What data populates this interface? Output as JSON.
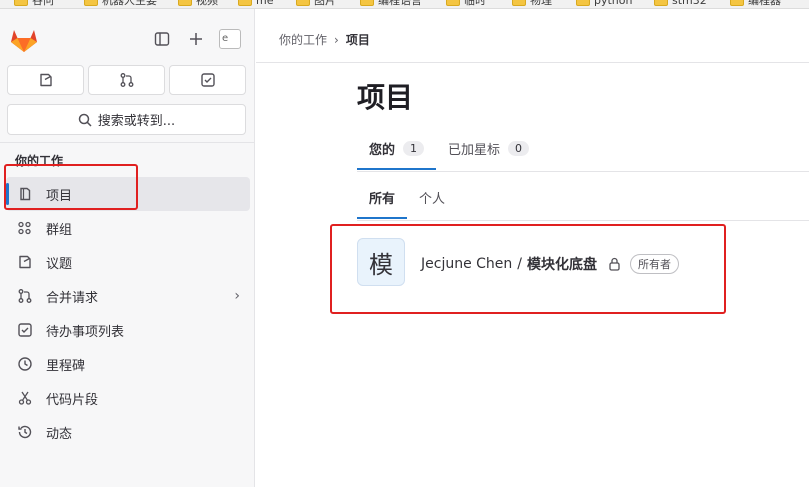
{
  "bookmarks": [
    "谷问",
    "机器人主要",
    "视频",
    "me",
    "图片",
    "编程语言",
    "临时",
    "物理",
    "python",
    "stm32",
    "编程器"
  ],
  "sidebar": {
    "search_label": "搜索或转到...",
    "avatar_alt": "e",
    "section_title": "你的工作",
    "items": [
      {
        "label": "项目",
        "icon": "project-icon",
        "active": true
      },
      {
        "label": "群组",
        "icon": "group-icon"
      },
      {
        "label": "议题",
        "icon": "issues-icon"
      },
      {
        "label": "合并请求",
        "icon": "merge-request-icon",
        "has_chevron": true
      },
      {
        "label": "待办事项列表",
        "icon": "todo-icon"
      },
      {
        "label": "里程碑",
        "icon": "milestone-icon"
      },
      {
        "label": "代码片段",
        "icon": "snippet-icon"
      },
      {
        "label": "动态",
        "icon": "activity-icon"
      }
    ]
  },
  "breadcrumb": {
    "parent": "你的工作",
    "separator": "›",
    "current": "项目"
  },
  "page": {
    "title": "项目",
    "tabs": [
      {
        "label": "您的",
        "count": "1",
        "active": true
      },
      {
        "label": "已加星标",
        "count": "0"
      }
    ],
    "subtabs": [
      {
        "label": "所有",
        "active": true
      },
      {
        "label": "个人"
      }
    ],
    "project": {
      "avatar_letter": "模",
      "namespace": "Jecjune Chen",
      "separator": "/",
      "name": "模块化底盘",
      "role": "所有者"
    }
  },
  "colors": {
    "accent": "#1f75cb",
    "annotation": "#e02020",
    "logo": "#e24329"
  }
}
